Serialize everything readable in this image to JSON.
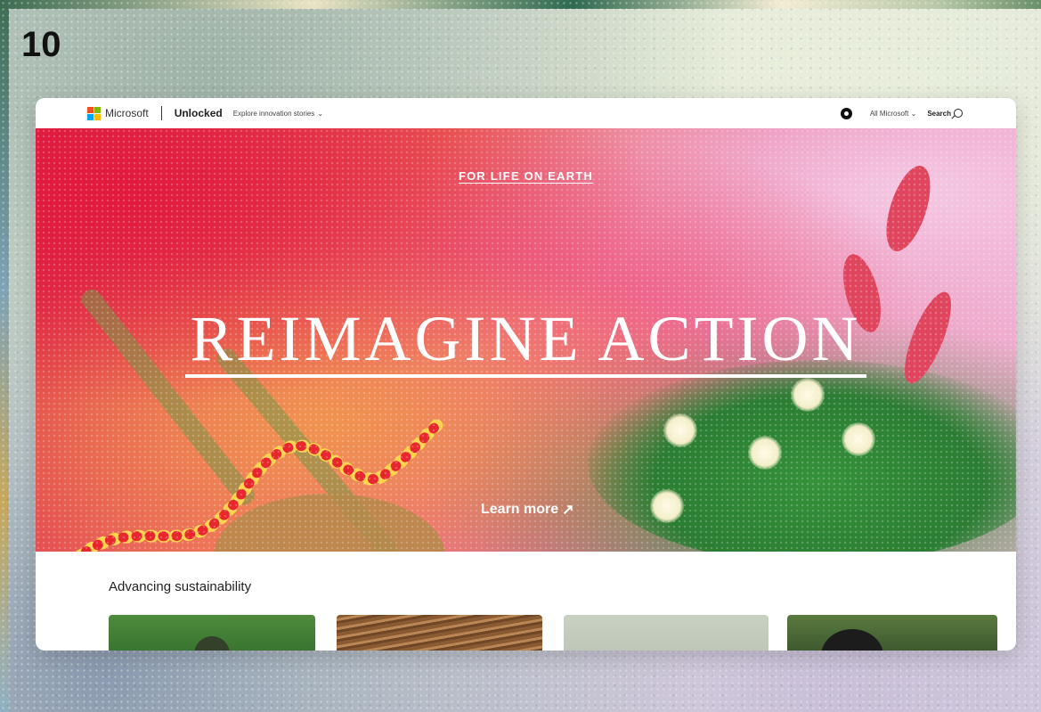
{
  "slide": {
    "number": "10"
  },
  "topbar": {
    "brand": "Microsoft",
    "site": "Unlocked",
    "explore_label": "Explore innovation stories",
    "all_microsoft_label": "All Microsoft",
    "search_label": "Search"
  },
  "hero": {
    "eyebrow": "FOR LIFE ON EARTH",
    "title": "REIMAGINE ACTION",
    "cta": "Learn more"
  },
  "section": {
    "title": "Advancing sustainability"
  },
  "icons": {
    "logo": "microsoft-logo",
    "gear": "gear-icon",
    "search": "search-icon",
    "chevron": "chevron-down-icon",
    "arrow": "arrow-up-right-icon"
  },
  "colors": {
    "hero_red": "#d91f45",
    "hero_pink": "#e86c97",
    "hero_green": "#2e8a35",
    "logo": [
      "#f25022",
      "#7fba00",
      "#00a4ef",
      "#ffb900"
    ]
  }
}
